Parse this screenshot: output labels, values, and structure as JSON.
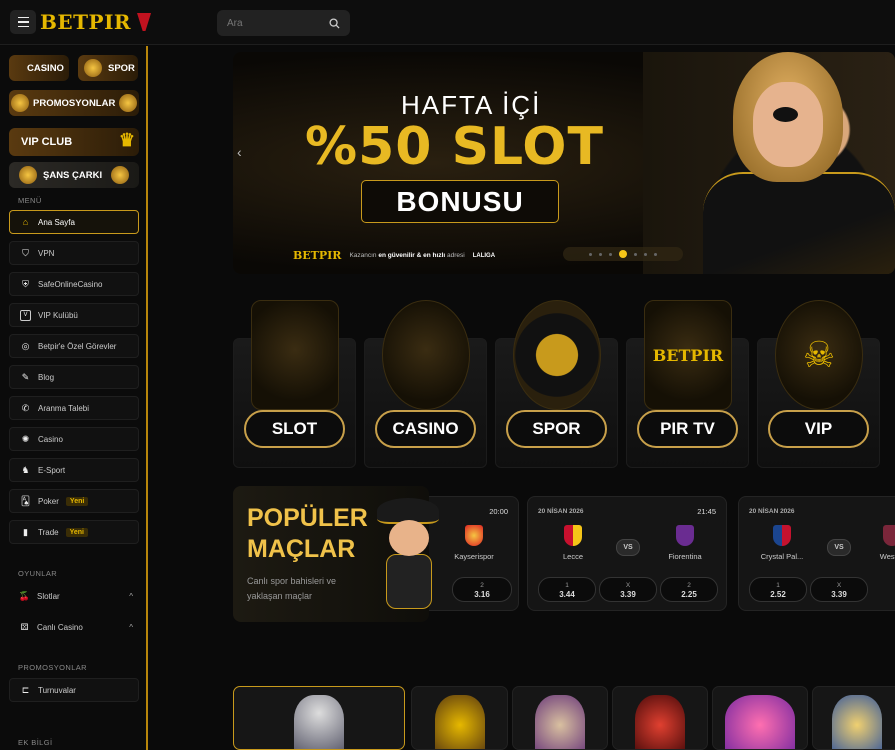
{
  "header": {
    "logo_text": "BETPIR",
    "search_placeholder": "Ara"
  },
  "sidebar": {
    "promos": [
      {
        "label": "CASINO"
      },
      {
        "label": "SPOR"
      },
      {
        "label": "PROMOSYONLAR"
      },
      {
        "label": "VIP CLUB"
      },
      {
        "label": "ŞANS ÇARKI"
      }
    ],
    "menu_label": "MENÜ",
    "menu": [
      {
        "label": "Ana Sayfa",
        "icon": "home-icon",
        "active": true
      },
      {
        "label": "VPN",
        "icon": "shield-icon"
      },
      {
        "label": "SafeOnlineCasino",
        "icon": "shield-check-icon"
      },
      {
        "label": "VIP Kulübü",
        "icon": "vip-icon"
      },
      {
        "label": "Betpir'e Özel Görevler",
        "icon": "target-icon"
      },
      {
        "label": "Blog",
        "icon": "edit-icon"
      },
      {
        "label": "Aranma Talebi",
        "icon": "phone-icon"
      },
      {
        "label": "Casino",
        "icon": "roulette-icon"
      },
      {
        "label": "E-Sport",
        "icon": "esport-icon"
      },
      {
        "label": "Poker",
        "icon": "cards-icon",
        "badge": "Yeni"
      },
      {
        "label": "Trade",
        "icon": "chart-icon",
        "badge": "Yeni"
      }
    ],
    "games_label": "OYUNLAR",
    "games": [
      {
        "label": "Slotlar",
        "icon": "cherry-icon"
      },
      {
        "label": "Canlı Casino",
        "icon": "dice-icon"
      }
    ],
    "promo_label": "PROMOSYONLAR",
    "promo_items": [
      {
        "label": "Turnuvalar",
        "icon": "bracket-icon"
      }
    ],
    "extra_label": "EK BİLGİ"
  },
  "banner": {
    "line1": "HAFTA İÇİ",
    "line2": "%50 SLOT",
    "line3": "BONUSU",
    "brand": "BETPIR",
    "tagline_prefix": "Kazancın",
    "tagline_bold1": "en güvenilir & en hızlı",
    "tagline_suffix": "adresi",
    "partner": "LALIGA",
    "active_slide": 4,
    "slide_count": 7
  },
  "categories": [
    {
      "label": "SLOT"
    },
    {
      "label": "CASINO"
    },
    {
      "label": "SPOR"
    },
    {
      "label": "PIR TV"
    },
    {
      "label": "VIP"
    }
  ],
  "popular": {
    "title_line1": "POPÜLER",
    "title_line2": "MAÇLAR",
    "desc": "Canlı spor bahisleri ve yaklaşan maçlar"
  },
  "matches": [
    {
      "date": "",
      "time": "20:00",
      "home": "",
      "away": "Kayserispor",
      "odds": [
        {
          "k": "",
          "v": ""
        },
        {
          "k": "2",
          "v": "3.16"
        }
      ]
    },
    {
      "date": "20 NİSAN 2026",
      "time": "21:45",
      "home": "Lecce",
      "away": "Fiorentina",
      "vs": "VS",
      "odds": [
        {
          "k": "1",
          "v": "3.44"
        },
        {
          "k": "X",
          "v": "3.39"
        },
        {
          "k": "2",
          "v": "2.25"
        }
      ]
    },
    {
      "date": "20 NİSAN 2026",
      "time": "",
      "home": "Crystal Pal...",
      "away": "West H",
      "vs": "VS",
      "odds": [
        {
          "k": "1",
          "v": "2.52"
        },
        {
          "k": "X",
          "v": "3.39"
        },
        {
          "k": "",
          "v": ""
        }
      ]
    }
  ],
  "colors": {
    "accent": "#e6b800",
    "gold_border": "#c89a1c",
    "bg": "#0a0a0a"
  }
}
